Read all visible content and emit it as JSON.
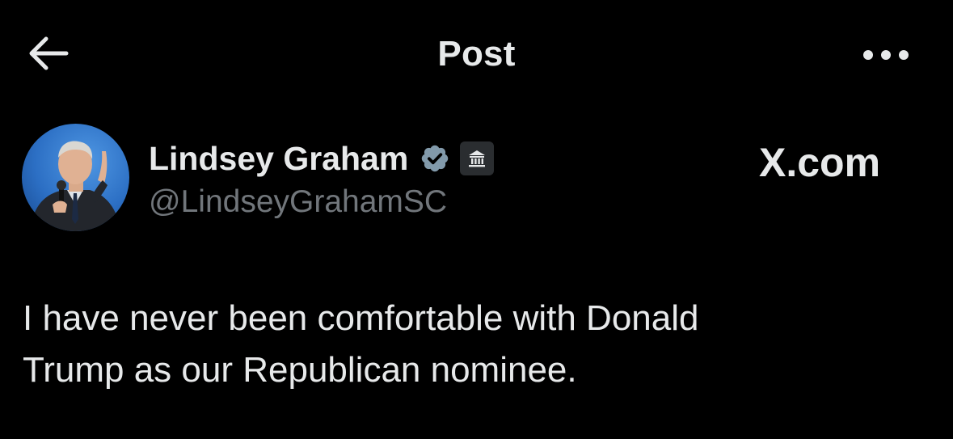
{
  "header": {
    "title": "Post",
    "back_icon": "arrow-left-icon",
    "more_icon": "more-horizontal-icon"
  },
  "author": {
    "display_name": "Lindsey Graham",
    "handle": "@LindseyGrahamSC",
    "verified_icon": "verified-badge-icon",
    "affiliation_icon": "government-building-icon",
    "watermark": "X.com"
  },
  "post": {
    "text": "I have never been comfortable with Donald\nTrump as our Republican nominee."
  },
  "colors": {
    "background": "#000000",
    "primary_text": "#e7e9ea",
    "secondary_text": "#71767b",
    "verified_badge": "#829aab"
  }
}
